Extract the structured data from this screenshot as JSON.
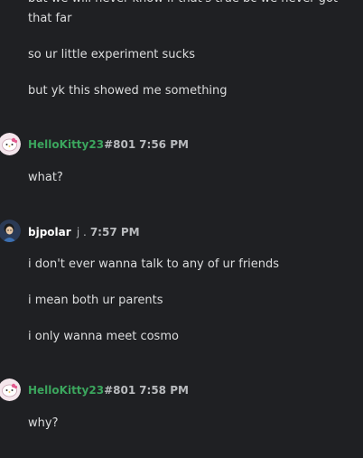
{
  "colors": {
    "background": "#1f2023",
    "message_text": "#dcddde",
    "muted_text": "#b9bbbe",
    "hellokitty_name": "#3ba55d",
    "bjpolar_name": "#ffffff"
  },
  "messages": [
    {
      "text": "but we will never know if that's true bc we never got"
    },
    {
      "text": "that far"
    },
    {
      "text": "so ur little experiment sucks"
    },
    {
      "text": "but yk this showed me something"
    },
    {
      "header": {
        "username": "HelloKitty23",
        "tag": "#801",
        "time": "7:56 PM",
        "avatar_icon": "hello-kitty-avatar-icon"
      },
      "text": "what?"
    },
    {
      "header": {
        "username": "bjpolar",
        "tag": "j .",
        "time": "7:57 PM",
        "avatar_icon": "character-avatar-icon"
      },
      "text": "i don't ever wanna talk to any of ur friends"
    },
    {
      "text": "i mean both ur parents"
    },
    {
      "text": "i only wanna meet cosmo"
    },
    {
      "header": {
        "username": "HelloKitty23",
        "tag": "#801",
        "time": "7:58 PM",
        "avatar_icon": "hello-kitty-avatar-icon"
      },
      "text": "why?"
    }
  ]
}
